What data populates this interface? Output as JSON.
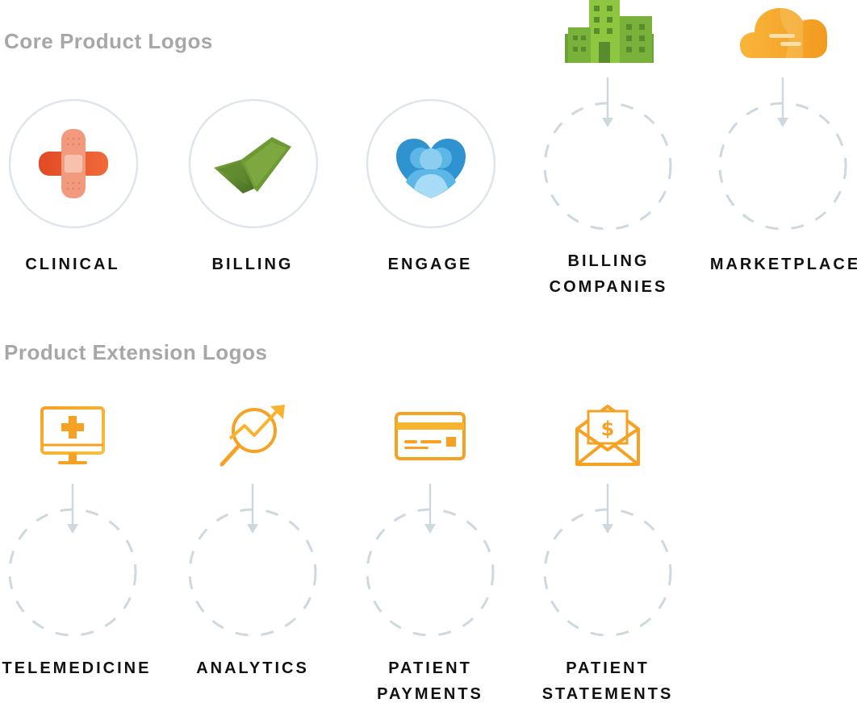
{
  "sections": {
    "core": {
      "title": "Core Product Logos"
    },
    "extension": {
      "title": "Product Extension Logos"
    }
  },
  "core_products": [
    {
      "name": "CLINICAL",
      "icon": "bandage-icon"
    },
    {
      "name": "BILLING",
      "icon": "checkmark-money-icon"
    },
    {
      "name": "ENGAGE",
      "icon": "heart-people-icon"
    },
    {
      "name_line1": "BILLING",
      "name_line2": "COMPANIES",
      "icon": "buildings-icon"
    },
    {
      "name": "MARKETPLACE",
      "icon": "cloud-icon"
    }
  ],
  "extension_products": [
    {
      "name": "TELEMEDICINE",
      "icon": "monitor-cross-icon"
    },
    {
      "name": "ANALYTICS",
      "icon": "magnifier-trend-icon"
    },
    {
      "name_line1": "PATIENT",
      "name_line2": "PAYMENTS",
      "icon": "credit-card-icon"
    },
    {
      "name_line1": "PATIENT",
      "name_line2": "STATEMENTS",
      "icon": "envelope-dollar-icon"
    }
  ],
  "colors": {
    "title_gray": "#a7a7a7",
    "ring_gray": "#dfe5ea",
    "dash_gray": "#cdd8df",
    "clinical_orange": "#e8542b",
    "billing_green": "#5b8a2c",
    "engage_blue": "#3ba0d8",
    "building_green": "#8dc63f",
    "cloud_orange": "#f5a623",
    "extension_orange": "#f7a123"
  }
}
